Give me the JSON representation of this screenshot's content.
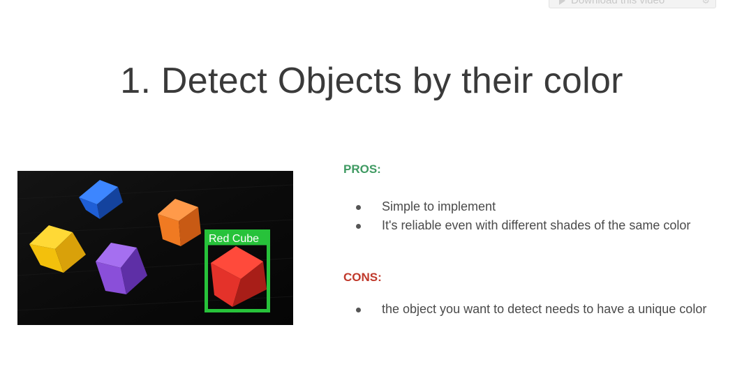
{
  "download_button": {
    "label": "Download this video"
  },
  "slide": {
    "title": "1. Detect Objects by their color",
    "image": {
      "box_label": "Red Cube",
      "cube_colors": {
        "blue": "#1f5fd6",
        "orange": "#f07a22",
        "yellow": "#f3c00c",
        "purple": "#8a4fd9",
        "red": "#e4322a"
      },
      "box_color": "#27c23a"
    },
    "pros": {
      "heading": "PROS:",
      "color": "#3f9a62",
      "items": [
        "Simple to implement",
        "It's reliable even with different shades of the same color"
      ]
    },
    "cons": {
      "heading": "CONS:",
      "color": "#c0392b",
      "items": [
        "the object you want to detect needs to have a unique color"
      ]
    }
  }
}
